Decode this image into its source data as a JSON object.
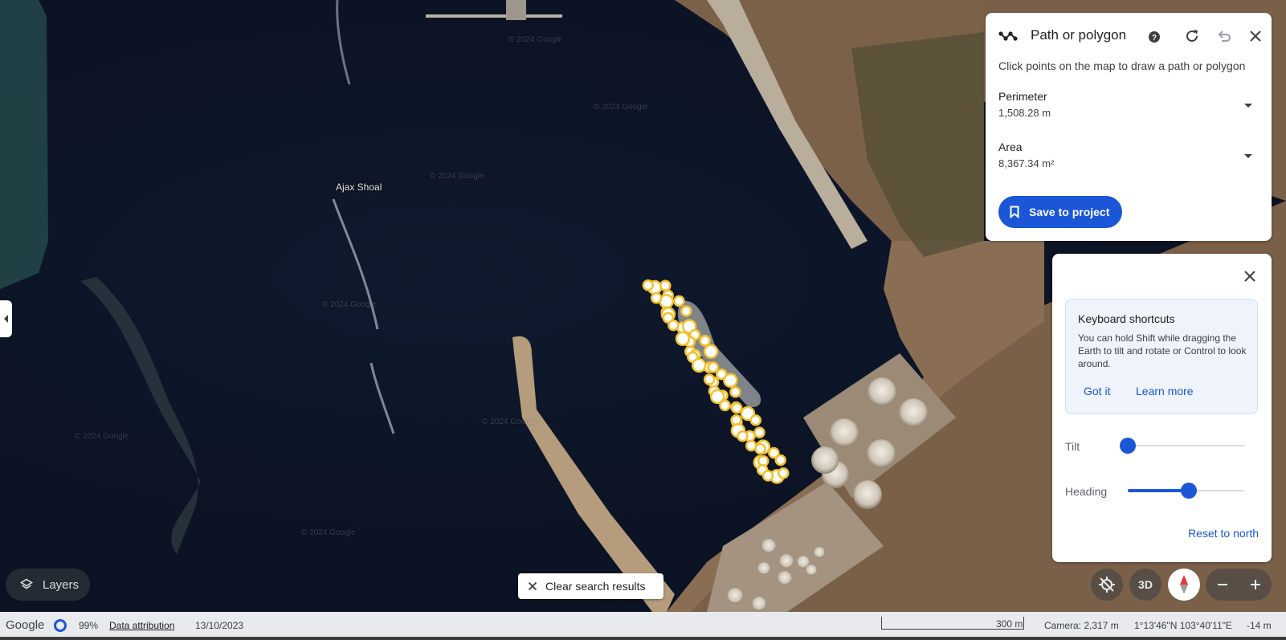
{
  "map": {
    "place_label": "Ajax Shoal",
    "watermark": "© 2024 Google"
  },
  "path_panel": {
    "title": "Path or polygon",
    "icons": [
      "path-icon",
      "help-icon",
      "refresh-icon",
      "undo-icon",
      "close-icon"
    ],
    "description": "Click points on the map to draw a path or polygon",
    "perimeter": {
      "label": "Perimeter",
      "value": "1,508.28 m"
    },
    "area": {
      "label": "Area",
      "value": "8,367.34 m²"
    },
    "save_button": "Save to project"
  },
  "nav_panel": {
    "shortcuts_title": "Keyboard shortcuts",
    "shortcuts_body": "You can hold Shift while dragging the Earth to tilt and rotate or Control to look around.",
    "got_it": "Got it",
    "learn_more": "Learn more",
    "tilt_label": "Tilt",
    "tilt_level": 0,
    "heading_label": "Heading",
    "heading_level": 0.52,
    "reset_north": "Reset to north"
  },
  "controls": {
    "layers": "Layers",
    "clear_search": "Clear search results",
    "mode_3d": "3D"
  },
  "status_bar": {
    "logo": "Google",
    "streaming": "99%",
    "data_attribution": "Data attribution",
    "date": "13/10/2023",
    "scale": "300 m",
    "camera": "Camera: 2,317 m",
    "coordinates": "1°13'46\"N 103°40'11\"E",
    "elevation": "-14 m"
  },
  "colors": {
    "accent": "#1a56d6",
    "ocean": "#0c1426",
    "land": "#7a6048",
    "marker": "#f3c130"
  }
}
